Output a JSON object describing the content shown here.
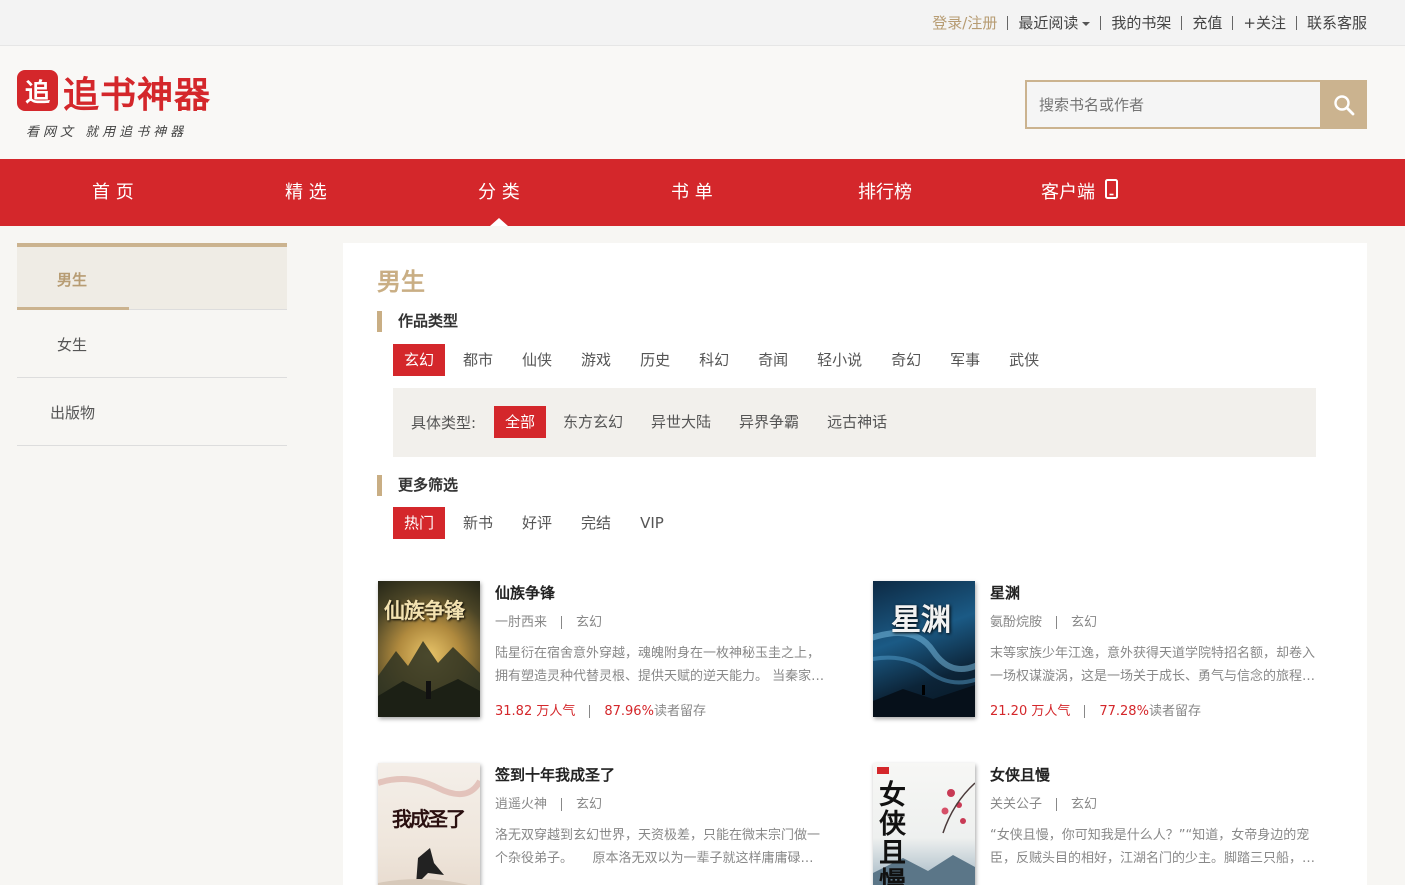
{
  "topbar": {
    "login": "登录/注册",
    "recent": "最近阅读",
    "shelf": "我的书架",
    "recharge": "充值",
    "follow": "+关注",
    "service": "联系客服"
  },
  "logo": {
    "badge": "追",
    "name": "追书神器",
    "slogan": "看网文 就用追书神器"
  },
  "search": {
    "placeholder": "搜索书名或作者"
  },
  "nav": {
    "items": [
      "首 页",
      "精 选",
      "分 类",
      "书 单",
      "排行榜",
      "客户端"
    ],
    "active": "分 类"
  },
  "sidebar": {
    "items": [
      "男生",
      "女生",
      "出版物"
    ],
    "active": "男生"
  },
  "main": {
    "title": "男生",
    "genre_section": "作品类型",
    "genres": [
      "玄幻",
      "都市",
      "仙侠",
      "游戏",
      "历史",
      "科幻",
      "奇闻",
      "轻小说",
      "奇幻",
      "军事",
      "武侠"
    ],
    "sub_label": "具体类型:",
    "subgenres": [
      "全部",
      "东方玄幻",
      "异世大陆",
      "异界争霸",
      "远古神话"
    ],
    "filter_section": "更多筛选",
    "filters": [
      "热门",
      "新书",
      "好评",
      "完结",
      "VIP"
    ]
  },
  "books": [
    {
      "title": "仙族争锋",
      "author": "一肘西来",
      "genre": "玄幻",
      "desc1": "陆星衍在宿舍意外穿越，魂魄附身在一枚神秘玉圭之上，",
      "desc2": "拥有塑造灵种代替灵根、提供天赋的逆天能力。 当秦家…",
      "popularity": "31.82 万人气",
      "retention_value": "87.96%",
      "retention_label": "读者留存",
      "cover_text": "仙族争锋"
    },
    {
      "title": "星渊",
      "author": "氨酚烷胺",
      "genre": "玄幻",
      "desc1": "末等家族少年江逸，意外获得天道学院特招名额，却卷入",
      "desc2": "一场权谋漩涡，这是一场关于成长、勇气与信念的旅程…",
      "popularity": "21.20 万人气",
      "retention_value": "77.28%",
      "retention_label": "读者留存",
      "cover_text": "星渊"
    },
    {
      "title": "签到十年我成圣了",
      "author": "逍遥火神",
      "genre": "玄幻",
      "desc1": "洛无双穿越到玄幻世界，天资极差，只能在微末宗门做一",
      "desc2": "个杂役弟子。　　原本洛无双以为一辈子就这样庸庸碌…",
      "cover_text": "我成圣了"
    },
    {
      "title": "女侠且慢",
      "author": "关关公子",
      "genre": "玄幻",
      "desc1": "“女侠且慢，你可知我是什么人？”“知道，女帝身边的宠",
      "desc2": "臣，反贼头目的相好，江湖名门的少主。脚踏三只船，…",
      "cover_text": "女侠且慢"
    }
  ],
  "colors": {
    "brand_red": "#d4272b",
    "accent_gold": "#cbb38f"
  }
}
